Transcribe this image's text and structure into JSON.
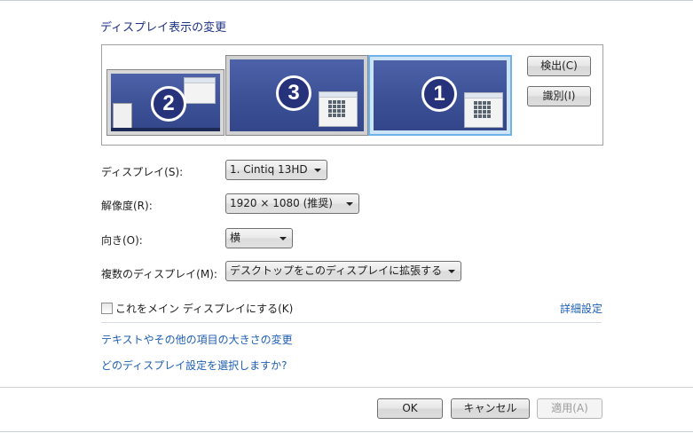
{
  "heading": "ディスプレイ表示の変更",
  "monitors": [
    {
      "number": "2"
    },
    {
      "number": "3"
    },
    {
      "number": "1"
    }
  ],
  "buttons": {
    "detect": "検出(C)",
    "identify": "識別(I)",
    "ok": "OK",
    "cancel": "キャンセル",
    "apply": "適用(A)"
  },
  "fields": {
    "display": {
      "label": "ディスプレイ(S):",
      "value": "1. Cintiq 13HD"
    },
    "resolution": {
      "label": "解像度(R):",
      "value": "1920 × 1080 (推奨)"
    },
    "orientation": {
      "label": "向き(O):",
      "value": "横"
    },
    "multiple": {
      "label": "複数のディスプレイ(M):",
      "value": "デスクトップをこのディスプレイに拡張する"
    }
  },
  "main_display_checkbox": {
    "label": "これをメイン ディスプレイにする(K)",
    "checked": false
  },
  "links": {
    "advanced": "詳細設定",
    "text_size": "テキストやその他の項目の大きさの変更",
    "which_settings": "どのディスプレイ設定を選択しますか?"
  },
  "colors": {
    "heading": "#1e3287",
    "link": "#1e5fb4",
    "monitor_fill": "#3b4f95",
    "selected_border": "#6fb2ea"
  }
}
